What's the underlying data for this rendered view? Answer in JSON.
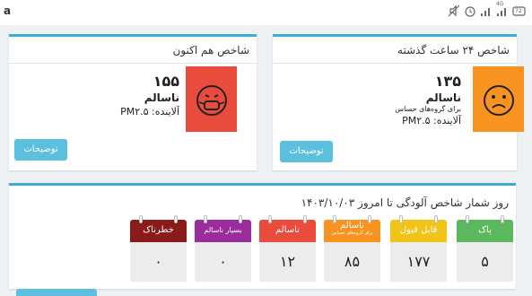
{
  "statusbar": {
    "left": "a",
    "icons": [
      "mute-icon",
      "alarm-icon",
      "signal-icon",
      "signal-4g-icon",
      "battery-icon"
    ],
    "network_label": "4G",
    "battery_level": "72"
  },
  "card_24h": {
    "title": "شاخص ۲۴ ساعت گذشته",
    "value": "۱۳۵",
    "status": "ناسالم",
    "note": "برای گروه‌های حساس",
    "pollutant": "آلاینده: PM۲.۵",
    "button": "توضیحات",
    "color": "#f7931e"
  },
  "card_now": {
    "title": "شاخص هم اکنون",
    "value": "۱۵۵",
    "status": "ناسالم",
    "pollutant": "آلاینده: PM۲.۵",
    "button": "توضیحات",
    "color": "#e94b3c"
  },
  "counter": {
    "title": "روز شمار شاخص آلودگی تا امروز ۱۴۰۳/۱۰/۰۳",
    "categories": [
      {
        "label": "پاک",
        "count": "۵",
        "color": "#5cb85c"
      },
      {
        "label": "قابل قبول",
        "count": "۱۷۷",
        "color": "#f0c419"
      },
      {
        "label": "ناسالم",
        "sub": "برای گروه‌های حساس",
        "count": "۸۵",
        "color": "#f7931e"
      },
      {
        "label": "ناسالم",
        "count": "۱۲",
        "color": "#e94b3c"
      },
      {
        "label": "بسیار ناسالم",
        "count": "۰",
        "color": "#9b2c9b"
      },
      {
        "label": "خطرناک",
        "count": "۰",
        "color": "#8b1a1a"
      }
    ]
  }
}
